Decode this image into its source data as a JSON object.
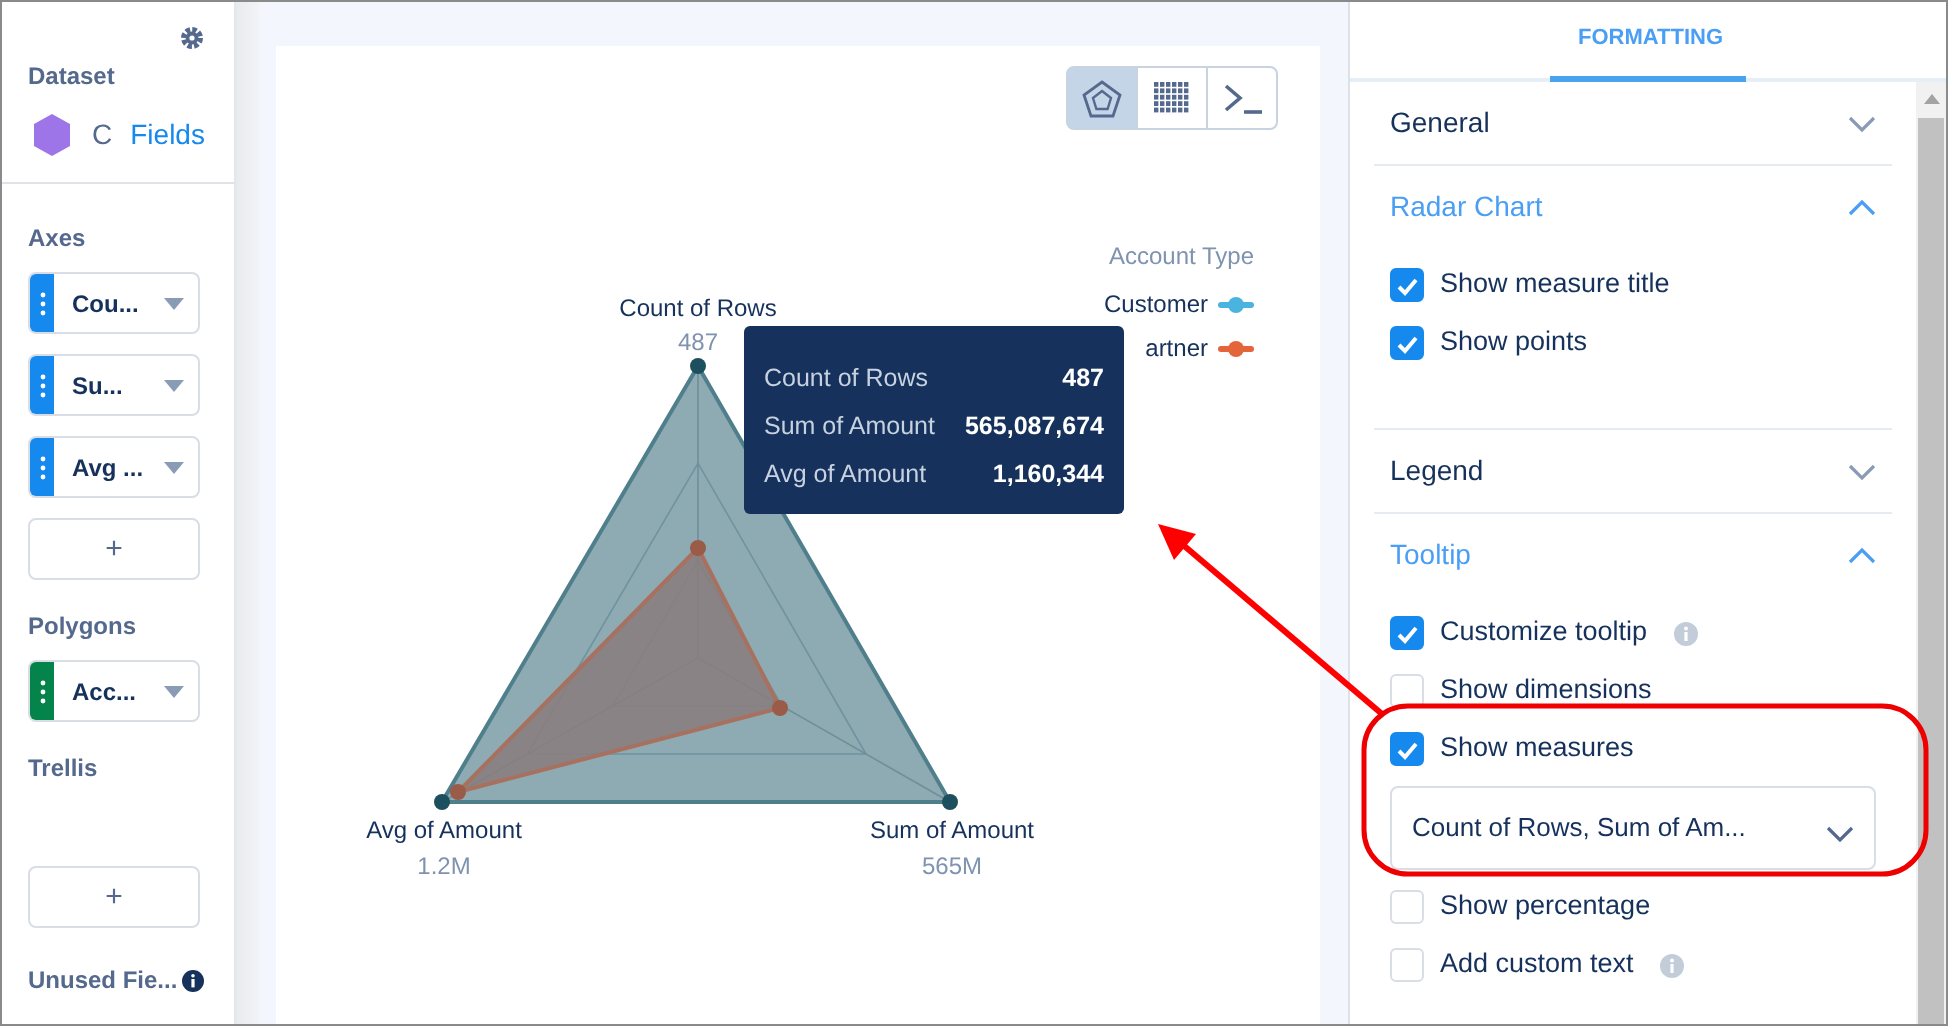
{
  "sidebar": {
    "dataset": {
      "title": "Dataset",
      "name": "C",
      "link": "Fields"
    },
    "sections": [
      {
        "title": "Axes",
        "fields": [
          {
            "label": "Cou...",
            "color": "#1589ee"
          },
          {
            "label": "Su...",
            "color": "#1589ee"
          },
          {
            "label": "Avg ...",
            "color": "#1589ee"
          }
        ],
        "add_button": "+"
      },
      {
        "title": "Polygons",
        "fields": [
          {
            "label": "Acc...",
            "color": "#04844b"
          }
        ]
      },
      {
        "title": "Trellis",
        "add_button": "+"
      }
    ],
    "unused": {
      "label": "Unused Fie..."
    }
  },
  "chart": {
    "toolbar": [
      {
        "kind": "radar",
        "selected": true
      },
      {
        "kind": "table",
        "selected": false
      },
      {
        "kind": "console",
        "selected": false
      }
    ],
    "axes": [
      {
        "label": "Count of Rows",
        "value": "487"
      },
      {
        "label": "Avg of Amount",
        "value": "1.2M"
      },
      {
        "label": "Sum of Amount",
        "value": "565M"
      }
    ],
    "legend": {
      "title": "Account Type",
      "items": [
        {
          "label": "Customer",
          "color": "#4bb3e0"
        },
        {
          "label": "artner",
          "color": "#e4653a"
        }
      ]
    },
    "tooltip": [
      {
        "label": "Count of Rows",
        "value": "487"
      },
      {
        "label": "Sum of Amount",
        "value": "565,087,674"
      },
      {
        "label": "Avg of Amount",
        "value": "1,160,344"
      }
    ]
  },
  "panel": {
    "tabs": [
      {
        "label": "FORMATTING",
        "selected": true
      }
    ],
    "sections": [
      {
        "title": "General",
        "expanded": false
      },
      {
        "title": "Radar Chart",
        "expanded": true,
        "options": [
          {
            "kind": "checkbox",
            "label": "Show measure title",
            "checked": true
          },
          {
            "kind": "checkbox",
            "label": "Show points",
            "checked": true
          }
        ]
      },
      {
        "title": "Legend",
        "expanded": false
      },
      {
        "title": "Tooltip",
        "expanded": true,
        "options": [
          {
            "kind": "checkbox",
            "label": "Customize tooltip",
            "checked": true,
            "info": true
          },
          {
            "kind": "checkbox",
            "label": "Show dimensions",
            "checked": false
          },
          {
            "kind": "checkbox",
            "label": "Show measures",
            "checked": true
          },
          {
            "kind": "select",
            "value": "Count of Rows, Sum of Am..."
          },
          {
            "kind": "checkbox",
            "label": "Show percentage",
            "checked": false
          },
          {
            "kind": "checkbox",
            "label": "Add custom text",
            "checked": false,
            "info": true
          }
        ]
      }
    ]
  }
}
